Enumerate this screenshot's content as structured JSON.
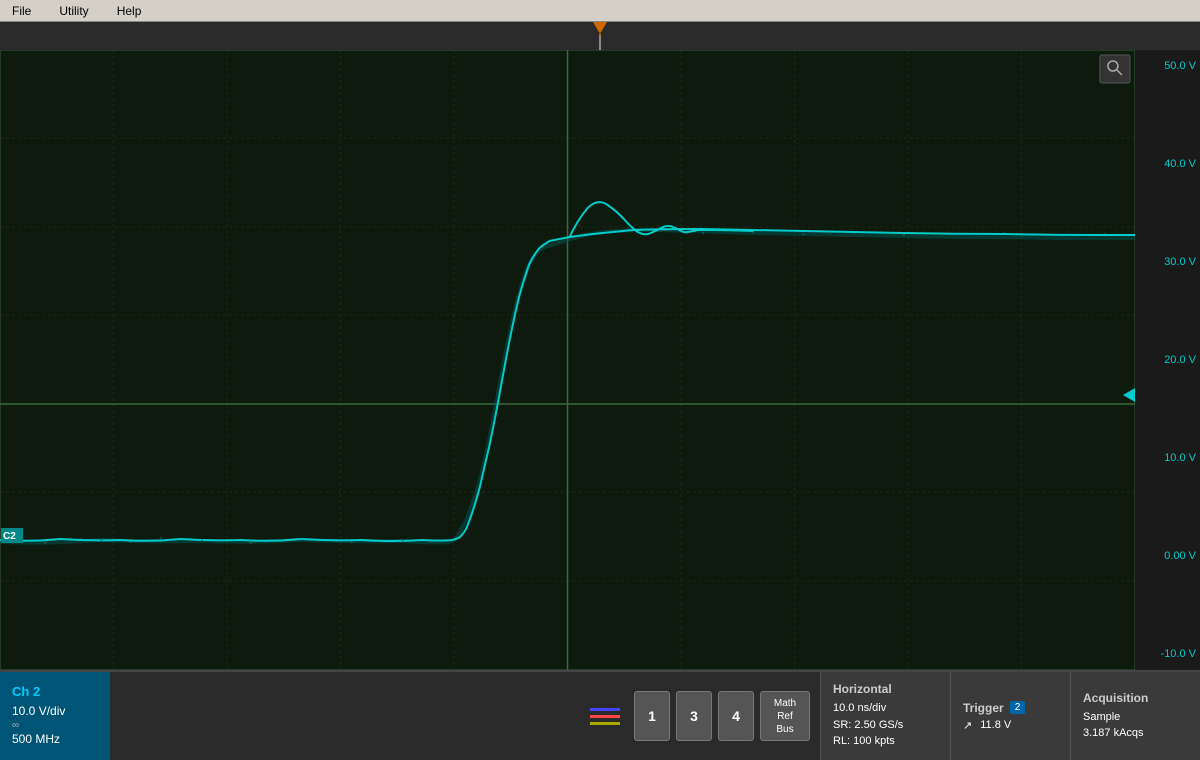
{
  "menu": {
    "file_label": "File",
    "utility_label": "Utility",
    "help_label": "Help"
  },
  "scope": {
    "grid_color": "#1a3a1a",
    "dot_color": "#2a4a2a",
    "waveform_color": "#00cccc",
    "trigger_marker_color": "#cc6600"
  },
  "right_scale": {
    "labels": [
      "50.0 V",
      "40.0 V",
      "30.0 V",
      "20.0 V",
      "10.0 V",
      "0.00 V",
      "-10.0 V"
    ]
  },
  "ch2_marker": "C2",
  "channel_buttons": [
    {
      "label": "1",
      "id": "ch1"
    },
    {
      "label": "3",
      "id": "ch3"
    },
    {
      "label": "4",
      "id": "ch4"
    }
  ],
  "math_ref_bus_label": "Math\nRef\nBus",
  "status": {
    "ch2": {
      "title": "Ch 2",
      "vdiv": "10.0 V/div",
      "bandwidth": "500 MHz",
      "icon": "∞"
    },
    "horizontal": {
      "title": "Horizontal",
      "time_div": "10.0 ns/div",
      "sample_rate": "SR: 2.50 GS/s",
      "record_length": "RL: 100 kpts"
    },
    "trigger": {
      "title": "Trigger",
      "channel": "2",
      "edge": "↗",
      "level": "11.8 V"
    },
    "acquisition": {
      "title": "Acquisition",
      "mode": "Sample",
      "rate": "3.187 kAcqs"
    }
  }
}
